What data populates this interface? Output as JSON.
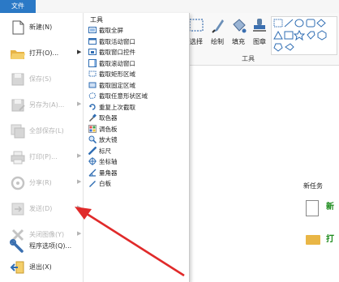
{
  "file_tab": {
    "label": "文件"
  },
  "ribbon": {
    "buttons": [
      {
        "label": "选择",
        "icon": "select-rect-icon"
      },
      {
        "label": "绘制",
        "icon": "brush-icon"
      },
      {
        "label": "填充",
        "icon": "fill-bucket-icon"
      },
      {
        "label": "图章",
        "icon": "stamp-icon"
      }
    ],
    "group_label": "工具"
  },
  "file_menu": {
    "items": [
      {
        "label": "新建(N)",
        "icon": "new-doc-icon",
        "arrow": "",
        "disabled": false
      },
      {
        "label": "打开(O)...",
        "icon": "open-folder-icon",
        "arrow": "▶",
        "disabled": false
      },
      {
        "label": "保存(S)",
        "icon": "save-icon",
        "arrow": "",
        "disabled": true
      },
      {
        "label": "另存为(A)...",
        "icon": "save-as-icon",
        "arrow": "▶",
        "disabled": true
      },
      {
        "label": "全部保存(L)",
        "icon": "save-all-icon",
        "arrow": "",
        "disabled": true
      },
      {
        "label": "打印(P)...",
        "icon": "print-icon",
        "arrow": "▶",
        "disabled": true
      },
      {
        "label": "分享(R)",
        "icon": "share-icon",
        "arrow": "▶",
        "disabled": true
      },
      {
        "label": "发送(D)",
        "icon": "send-icon",
        "arrow": "▶",
        "disabled": true
      },
      {
        "label": "关闭图像(Y)",
        "icon": "close-x-icon",
        "arrow": "▶",
        "disabled": true
      },
      {
        "label": "程序选项(Q)...",
        "icon": "wrench-icon",
        "arrow": "",
        "disabled": false
      },
      {
        "label": "退出(X)",
        "icon": "exit-icon",
        "arrow": "",
        "disabled": false
      }
    ]
  },
  "tools_panel": {
    "title": "工具",
    "items": [
      {
        "label": "截取全屏",
        "icon": "fullscreen-capture-icon"
      },
      {
        "label": "截取活动窗口",
        "icon": "active-window-capture-icon"
      },
      {
        "label": "截取窗口控件",
        "icon": "window-control-capture-icon"
      },
      {
        "label": "截取滚动窗口",
        "icon": "scrolling-window-capture-icon"
      },
      {
        "label": "截取矩形区域",
        "icon": "rect-region-capture-icon"
      },
      {
        "label": "截取固定区域",
        "icon": "fixed-region-capture-icon"
      },
      {
        "label": "截取任意形状区域",
        "icon": "freehand-region-capture-icon"
      },
      {
        "label": "重复上次截取",
        "icon": "repeat-capture-icon"
      },
      {
        "label": "取色器",
        "icon": "color-picker-icon"
      },
      {
        "label": "调色板",
        "icon": "palette-icon"
      },
      {
        "label": "放大镜",
        "icon": "magnifier-icon"
      },
      {
        "label": "标尺",
        "icon": "ruler-icon"
      },
      {
        "label": "坐标轴",
        "icon": "crosshair-icon"
      },
      {
        "label": "量角器",
        "icon": "protractor-icon"
      },
      {
        "label": "白板",
        "icon": "whiteboard-icon"
      }
    ]
  },
  "background": {
    "new_task_label": "新任务"
  },
  "colors": {
    "accent": "#2b79c6",
    "annotation_arrow": "#e02a2a",
    "disabled_text": "#b5b5b5"
  }
}
